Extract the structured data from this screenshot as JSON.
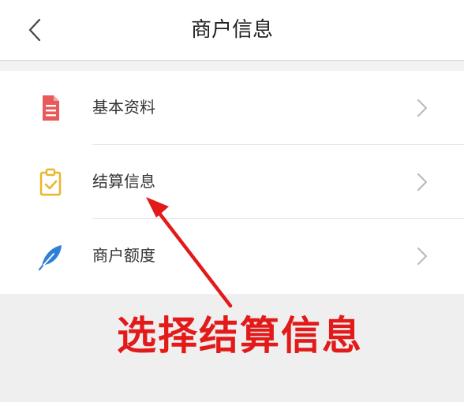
{
  "header": {
    "title": "商户信息",
    "back_icon": "chevron-left-icon"
  },
  "menu": {
    "items": [
      {
        "label": "基本资料",
        "icon": "document-icon",
        "icon_color": "#e85a5a"
      },
      {
        "label": "结算信息",
        "icon": "clipboard-check-icon",
        "icon_color": "#e9b72e"
      },
      {
        "label": "商户额度",
        "icon": "feather-icon",
        "icon_color": "#2f7fd8"
      }
    ],
    "chevron_icon": "chevron-right-icon"
  },
  "annotation": {
    "text": "选择结算信息",
    "color": "#e21a1a"
  }
}
